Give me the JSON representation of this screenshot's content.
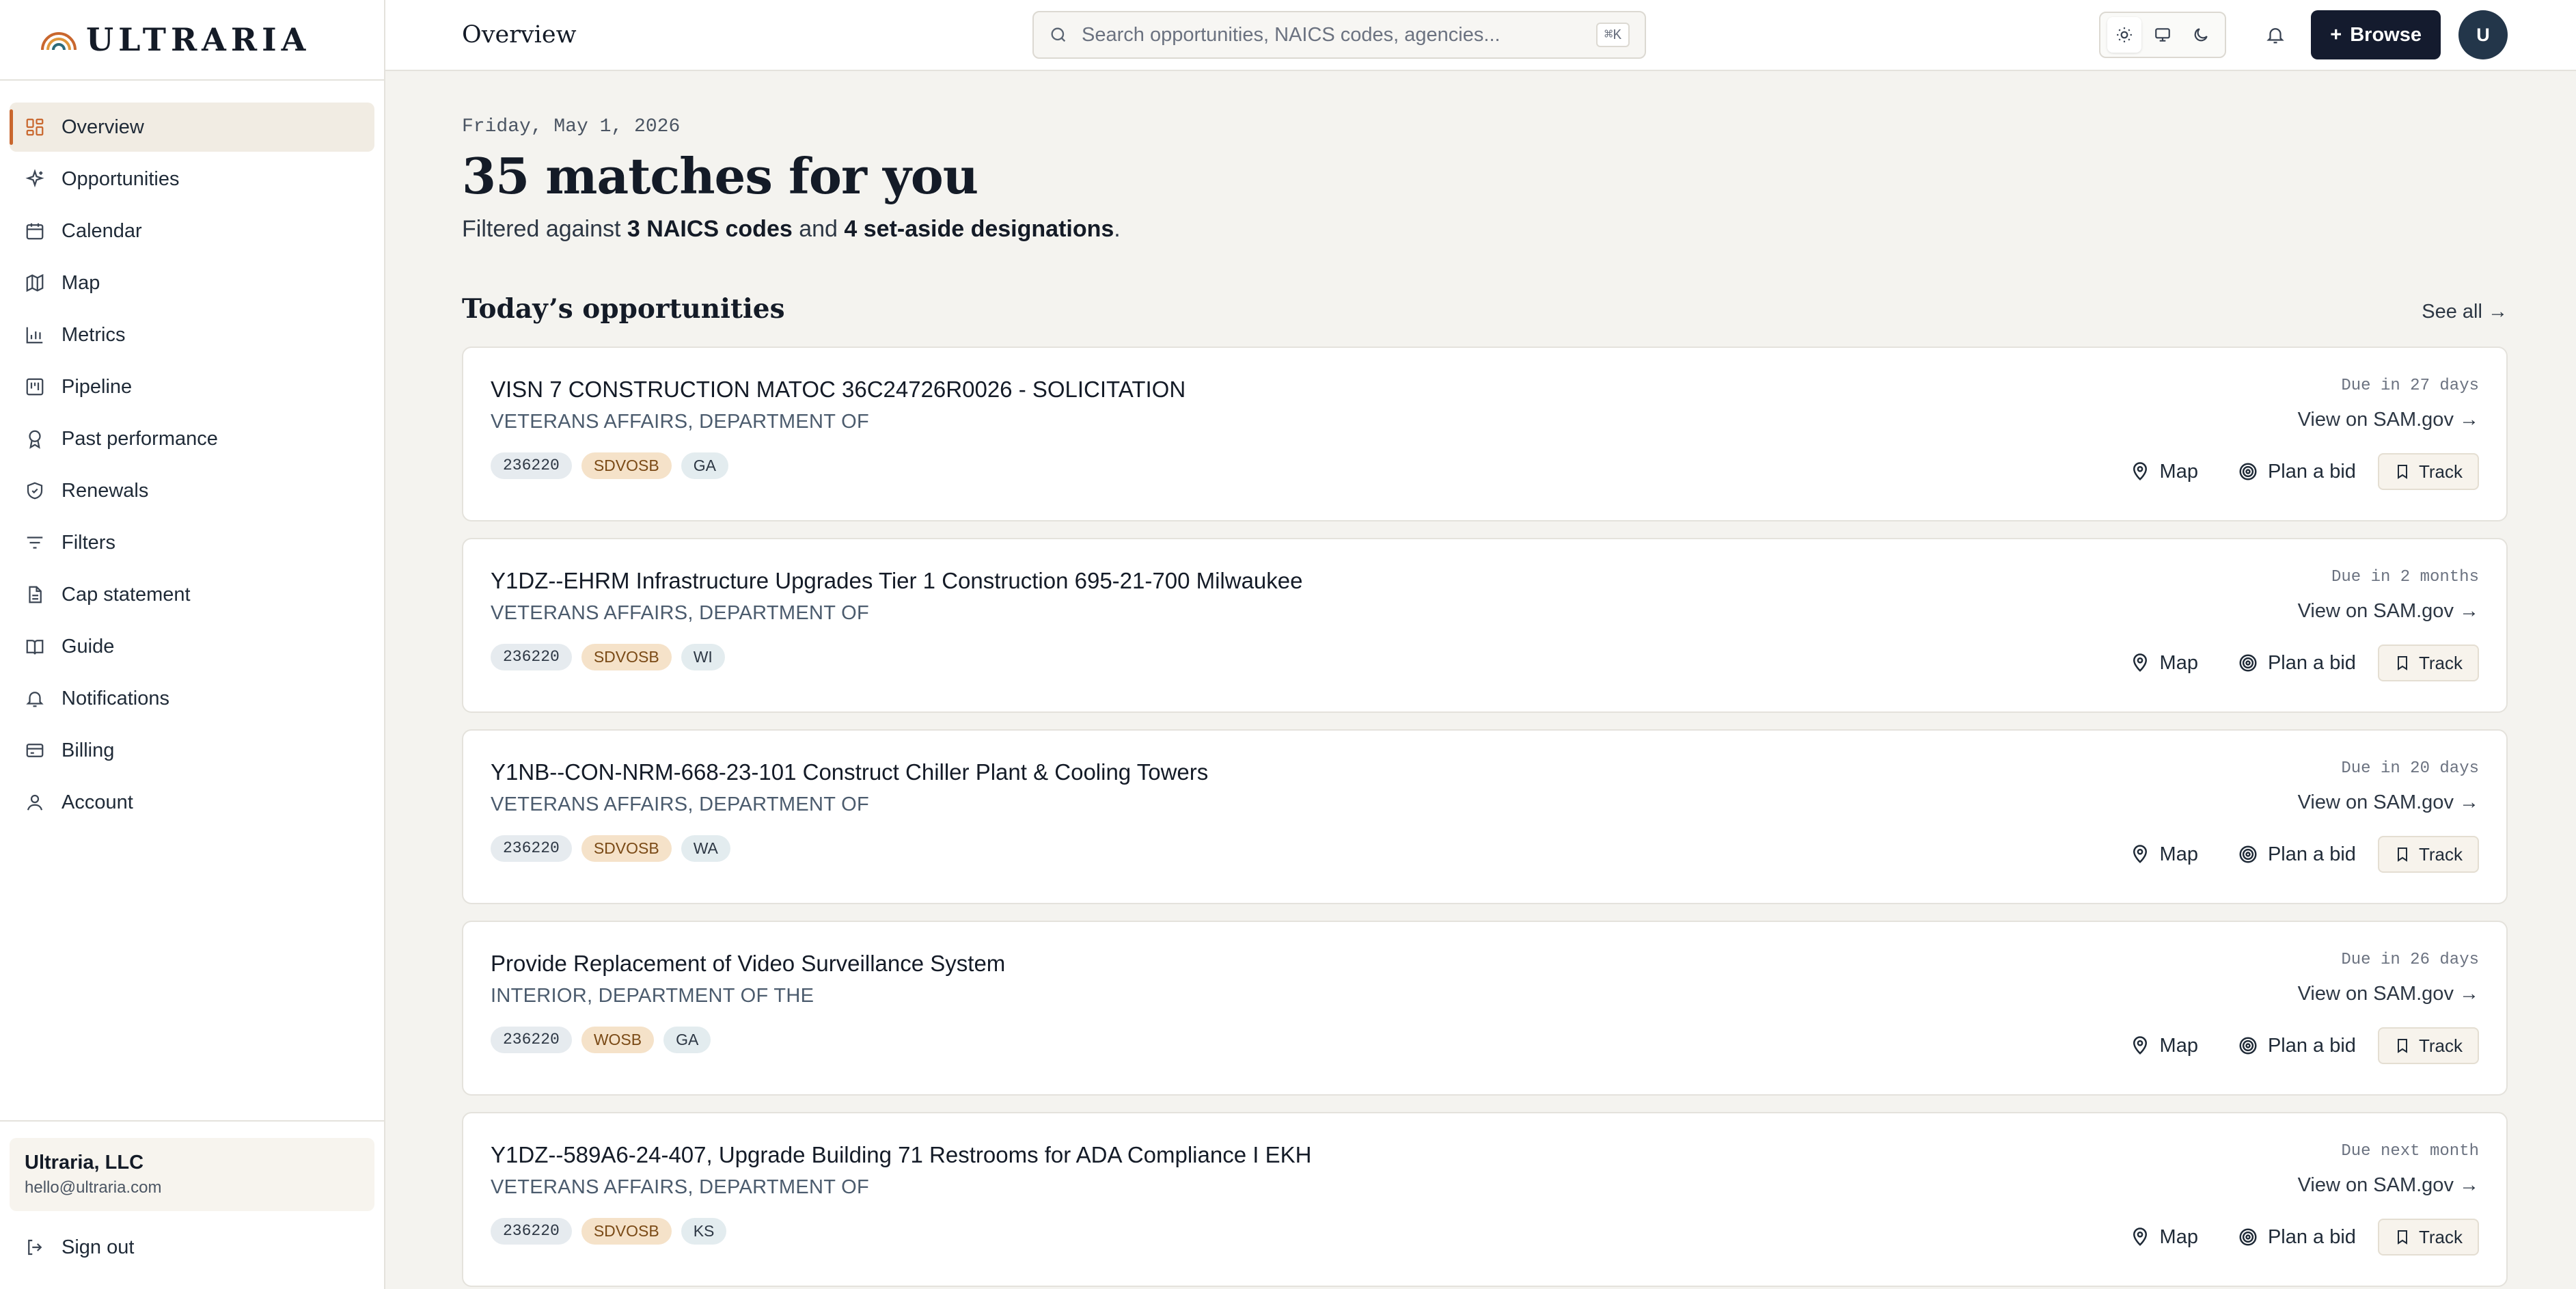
{
  "brand": {
    "name": "ULTRARIA",
    "accent": "#c9672e"
  },
  "sidebar": {
    "items": [
      {
        "label": "Overview",
        "icon": "grid-icon",
        "active": true
      },
      {
        "label": "Opportunities",
        "icon": "sparkle-icon"
      },
      {
        "label": "Calendar",
        "icon": "calendar-icon"
      },
      {
        "label": "Map",
        "icon": "map-icon"
      },
      {
        "label": "Metrics",
        "icon": "bar-chart-icon"
      },
      {
        "label": "Pipeline",
        "icon": "kanban-icon"
      },
      {
        "label": "Past performance",
        "icon": "award-icon"
      },
      {
        "label": "Renewals",
        "icon": "shield-check-icon"
      },
      {
        "label": "Filters",
        "icon": "filter-icon"
      },
      {
        "label": "Cap statement",
        "icon": "document-icon"
      },
      {
        "label": "Guide",
        "icon": "book-icon"
      },
      {
        "label": "Notifications",
        "icon": "bell-icon"
      },
      {
        "label": "Billing",
        "icon": "credit-card-icon"
      },
      {
        "label": "Account",
        "icon": "user-icon"
      }
    ],
    "org": {
      "name": "Ultraria, LLC",
      "email": "hello@ultraria.com"
    },
    "signout": "Sign out"
  },
  "header": {
    "title": "Overview",
    "search_placeholder": "Search opportunities, NAICS codes, agencies...",
    "search_shortcut": "⌘K",
    "browse_label": "Browse",
    "avatar_initial": "U"
  },
  "main": {
    "date": "Friday, May 1, 2026",
    "headline": "35 matches for you",
    "sub_prefix": "Filtered against ",
    "sub_naics": "3 NAICS codes",
    "sub_and": " and ",
    "sub_setaside": "4 set-aside designations",
    "sub_suffix": ".",
    "section_title": "Today’s opportunities",
    "see_all": "See all →"
  },
  "card_labels": {
    "sam": "View on SAM.gov →",
    "map": "Map",
    "plan": "Plan a bid",
    "track": "Track"
  },
  "opportunities": [
    {
      "title": "VISN 7 CONSTRUCTION MATOC 36C24726R0026 - SOLICITATION",
      "agency": "VETERANS AFFAIRS, DEPARTMENT OF",
      "naics": "236220",
      "set_aside": "SDVOSB",
      "state": "GA",
      "due": "Due in 27 days"
    },
    {
      "title": "Y1DZ--EHRM Infrastructure Upgrades Tier 1 Construction 695-21-700 Milwaukee",
      "agency": "VETERANS AFFAIRS, DEPARTMENT OF",
      "naics": "236220",
      "set_aside": "SDVOSB",
      "state": "WI",
      "due": "Due in 2 months"
    },
    {
      "title": "Y1NB--CON-NRM-668-23-101 Construct Chiller Plant & Cooling Towers",
      "agency": "VETERANS AFFAIRS, DEPARTMENT OF",
      "naics": "236220",
      "set_aside": "SDVOSB",
      "state": "WA",
      "due": "Due in 20 days"
    },
    {
      "title": "Provide Replacement of Video Surveillance System",
      "agency": "INTERIOR, DEPARTMENT OF THE",
      "naics": "236220",
      "set_aside": "WOSB",
      "state": "GA",
      "due": "Due in 26 days"
    },
    {
      "title": "Y1DZ--589A6-24-407, Upgrade Building 71 Restrooms for ADA Compliance I EKH",
      "agency": "VETERANS AFFAIRS, DEPARTMENT OF",
      "naics": "236220",
      "set_aside": "SDVOSB",
      "state": "KS",
      "due": "Due next month"
    }
  ]
}
